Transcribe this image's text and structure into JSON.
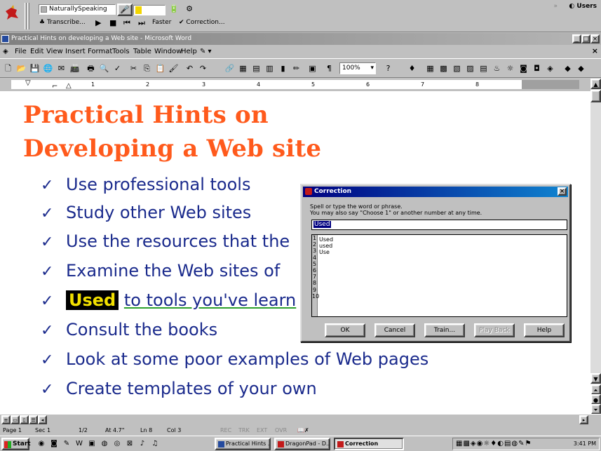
{
  "dragon_bar": {
    "app_name": "NaturallySpeaking",
    "transcribe_label": "Transcribe...",
    "faster_label": "Faster",
    "correction_label": "Correction...",
    "users_label": "Users",
    "mic_level": 0.2,
    "accent_color": "#f2d500"
  },
  "word_window": {
    "title": "Practical Hints on developing a Web site - Microsoft Word",
    "menu": [
      "File",
      "Edit",
      "View",
      "Insert",
      "Format",
      "Tools",
      "Table",
      "Window",
      "Help"
    ],
    "zoom_value": "100%"
  },
  "ruler": {
    "numbers": [
      "1",
      "2",
      "3",
      "4",
      "5",
      "6",
      "7",
      "8"
    ]
  },
  "document": {
    "title_line1": "Practical Hints on",
    "title_line2": "Developing a Web site",
    "title_color": "#ff5a1c",
    "bullet_color": "#1a2a8c",
    "bullets": [
      "Use professional tools",
      "Study other Web sites",
      "Use the resources that the",
      "Examine the Web sites of",
      "to tools you've learn",
      "Consult the books",
      "Look at some poor examples of Web pages",
      "Create templates of your own"
    ],
    "highlighted_word": "Used",
    "check_glyph": "✓"
  },
  "correction_dialog": {
    "title": "Correction",
    "instruction_line1": "Spell or type the word or phrase.",
    "instruction_line2": "You may also say \"Choose 1\" or another number at any time.",
    "input_value": "Used",
    "list_numbers": [
      "1",
      "2",
      "3",
      "4",
      "5",
      "6",
      "7",
      "8",
      "9",
      "10"
    ],
    "choices": [
      "Used",
      "used",
      "Use"
    ],
    "buttons": {
      "ok": "OK",
      "cancel": "Cancel",
      "train": "Train...",
      "play_back": "Play Back",
      "help": "Help"
    }
  },
  "status_bar": {
    "page": "Page 1",
    "sec": "Sec 1",
    "pages": "1/2",
    "at": "At 4.7\"",
    "ln": "Ln 8",
    "col": "Col 3",
    "rec": "REC",
    "trk": "TRK",
    "ext": "EXT",
    "ovr": "OVR"
  },
  "taskbar": {
    "start_label": "Start",
    "tasks": [
      "Practical Hints ...",
      "DragonPad - D...",
      "Correction"
    ],
    "clock": "3:41 PM"
  }
}
